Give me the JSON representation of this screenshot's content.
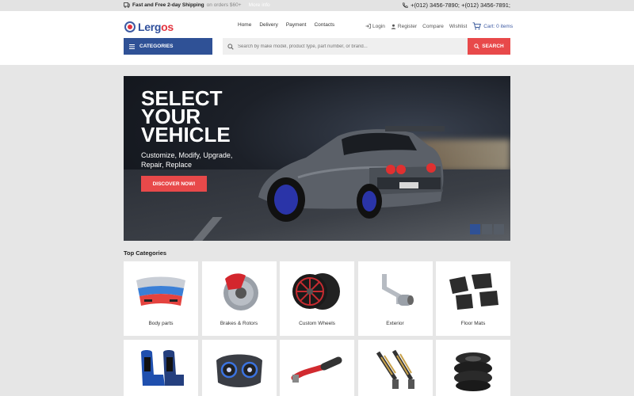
{
  "topbar": {
    "ship_strong": "Fast and Free 2-day Shipping",
    "ship_muted": "on orders $60+",
    "more_info": "More info",
    "phones": "+(012) 3456-7890; +(012) 3456-7891;"
  },
  "header": {
    "logo_a": "Lerg",
    "logo_b": "os",
    "nav": [
      "Home",
      "Delivery",
      "Payment",
      "Contacts"
    ],
    "login": "Login",
    "register": "Register",
    "compare": "Compare",
    "wishlist": "Wishlist",
    "cart": "Cart: 0 items",
    "categories_label": "CATEGORIES",
    "search_placeholder": "Search by make model, product type, part number, or brand...",
    "search_button": "SEARCH"
  },
  "hero": {
    "title": "SELECT YOUR VEHICLE",
    "subtitle": "Customize, Modify, Upgrade, Repair, Replace",
    "cta": "DISCOVER NOW!",
    "slides_total": 3,
    "active_slide": 1
  },
  "categories": {
    "title": "Top Categories",
    "items": [
      {
        "label": "Body parts",
        "icon": "bumper-icon"
      },
      {
        "label": "Brakes & Rotors",
        "icon": "brake-icon"
      },
      {
        "label": "Custom Wheels",
        "icon": "wheel-icon"
      },
      {
        "label": "Exterior",
        "icon": "exhaust-icon"
      },
      {
        "label": "Floor Mats",
        "icon": "floor-mat-icon"
      },
      {
        "label": "",
        "icon": "seat-icon"
      },
      {
        "label": "",
        "icon": "headlight-icon"
      },
      {
        "label": "",
        "icon": "intake-icon"
      },
      {
        "label": "",
        "icon": "suspension-icon"
      },
      {
        "label": "",
        "icon": "tires-icon"
      }
    ]
  },
  "colors": {
    "brand_blue": "#2f5196",
    "accent_red": "#e8494a"
  }
}
